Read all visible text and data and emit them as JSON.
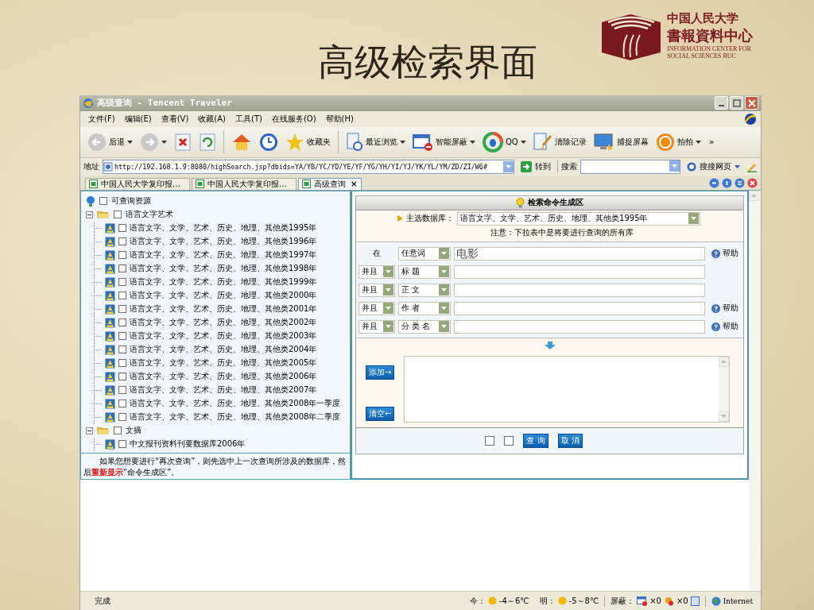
{
  "slide": {
    "title": "高级检索界面",
    "logo": {
      "org": "中国人民大学",
      "center": "書報資料中心",
      "english_1": "INFORMATION CENTER FOR",
      "english_2": "SOCIAL SCIENCES RUC"
    }
  },
  "window": {
    "title": "高级查询 - Tencent Traveler"
  },
  "menu": [
    "文件(F)",
    "编辑(E)",
    "查看(V)",
    "收藏(A)",
    "工具(T)",
    "在线服务(O)",
    "帮助(H)"
  ],
  "toolbar": [
    {
      "kind": "back",
      "label": "后退",
      "dropdown": true
    },
    {
      "kind": "forward",
      "dropdown": true
    },
    {
      "kind": "stop"
    },
    {
      "kind": "refresh"
    },
    {
      "kind": "separator"
    },
    {
      "kind": "home"
    },
    {
      "kind": "history"
    },
    {
      "kind": "favorites",
      "label": "收藏夹"
    },
    {
      "kind": "separator"
    },
    {
      "kind": "recent",
      "label": "最近浏览",
      "dropdown": true
    },
    {
      "kind": "block",
      "label": "智能屏蔽",
      "dropdown": true
    },
    {
      "kind": "qq",
      "label": "QQ",
      "dropdown": true
    },
    {
      "kind": "clear",
      "label": "清除记录"
    },
    {
      "kind": "capture",
      "label": "捕捉屏幕"
    },
    {
      "kind": "paipai",
      "label": "拍拍",
      "dropdown": true
    },
    {
      "kind": "more",
      "label": "»"
    }
  ],
  "address": {
    "label": "地址",
    "url": "http://192.168.1.9:8080/highSearch.jsp?dbids=YA/YB/YC/YD/YE/YF/YG/YH/YI/YJ/YK/YL/YM/ZD/ZI/W6#",
    "go": "转到",
    "search_label": "搜索",
    "search_engine": "搜搜网页"
  },
  "tabs": [
    {
      "label": "中国人民大学复印报…",
      "selected": false
    },
    {
      "label": "中国人民大学复印报…",
      "selected": false
    },
    {
      "label": "高级查询",
      "selected": true,
      "close": "×"
    }
  ],
  "tree": {
    "label": "可查询资源",
    "checked": false,
    "children": [
      {
        "label": "语言文字艺术",
        "expanded": true,
        "checked": false,
        "children": [
          {
            "label": "语言文字、文学、艺术、历史、地理、其他类1995年",
            "checked": false
          },
          {
            "label": "语言文字、文学、艺术、历史、地理、其他类1996年",
            "checked": false
          },
          {
            "label": "语言文字、文学、艺术、历史、地理、其他类1997年",
            "checked": false
          },
          {
            "label": "语言文字、文学、艺术、历史、地理、其他类1998年",
            "checked": false
          },
          {
            "label": "语言文字、文学、艺术、历史、地理、其他类1999年",
            "checked": false
          },
          {
            "label": "语言文字、文学、艺术、历史、地理、其他类2000年",
            "checked": false
          },
          {
            "label": "语言文字、文学、艺术、历史、地理、其他类2001年",
            "checked": false
          },
          {
            "label": "语言文字、文学、艺术、历史、地理、其他类2002年",
            "checked": false
          },
          {
            "label": "语言文字、文学、艺术、历史、地理、其他类2003年",
            "checked": false
          },
          {
            "label": "语言文字、文学、艺术、历史、地理、其他类2004年",
            "checked": false
          },
          {
            "label": "语言文字、文学、艺术、历史、地理、其他类2005年",
            "checked": false
          },
          {
            "label": "语言文字、文学、艺术、历史、地理、其他类2006年",
            "checked": false
          },
          {
            "label": "语言文字、文学、艺术、历史、地理、其他类2007年",
            "checked": false
          },
          {
            "label": "语言文字、文学、艺术、历史、地理、其他类2008年一季度",
            "checked": false
          },
          {
            "label": "语言文字、文学、艺术、历史、地理、其他类2008年二季度",
            "checked": false
          }
        ]
      },
      {
        "label": "文摘",
        "expanded": true,
        "checked": false,
        "children": [
          {
            "label": "中文报刊资料刊要数据库2006年",
            "checked": false
          }
        ]
      }
    ]
  },
  "note": "　　如果您想要进行“再次查询”，则先选中上一次查询所涉及的数据库，然后**重新显示**“命令生成区”。",
  "search": {
    "header": "检索命令生成区",
    "db_label": "主选数据库：",
    "db_value": "语言文字、文学、艺术、历史、地理、其他类1995年",
    "db_note": "注意：下拉表中是将要进行查询的所有库",
    "rows": [
      {
        "kind": "first",
        "prefix": "在",
        "field": "任意词",
        "value": "电影",
        "help": "帮助"
      },
      {
        "kind": "joined",
        "operator": "并且",
        "field": "标 题"
      },
      {
        "kind": "joined",
        "operator": "并且",
        "field": "正 文"
      },
      {
        "kind": "joined",
        "operator": "并且",
        "field": "作 者",
        "help": "帮助"
      },
      {
        "kind": "joined",
        "operator": "并且",
        "field": "分 类 名",
        "help": "帮助"
      }
    ],
    "add_button": "添加→",
    "clear_button": "清空←",
    "options": [
      {
        "checked": false
      },
      {
        "checked": false
      }
    ],
    "query_button": "查 询",
    "cancel_button": "取 消"
  },
  "status": {
    "text": "完成",
    "today_label": "今：",
    "today_weather": "-4～6℃",
    "tomorrow_label": "明：",
    "tomorrow_weather": "-5～8℃",
    "block_label": "屏蔽：",
    "popup_count": "×0",
    "ad_count": "×0",
    "zone": "Internet"
  }
}
